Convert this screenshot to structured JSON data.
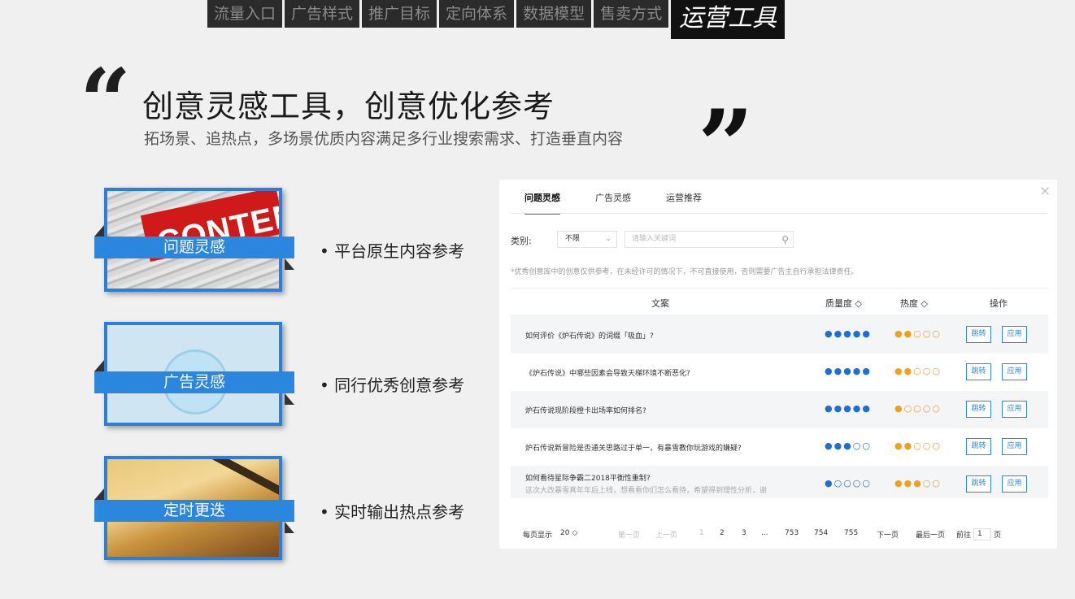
{
  "topnav": {
    "tabs": [
      "流量入口",
      "广告样式",
      "推广目标",
      "定向体系",
      "数据模型",
      "售卖方式"
    ],
    "active": "运营工具"
  },
  "heading": {
    "title": "创意灵感工具，创意优化参考",
    "subtitle": "拓场景、追热点，多场景优质内容满足多行业搜索需求、打造垂直内容"
  },
  "features": [
    {
      "label": "问题灵感",
      "bullet": "平台原生内容参考",
      "image_text": "CONTENT"
    },
    {
      "label": "广告灵感",
      "bullet": "同行优秀创意参考"
    },
    {
      "label": "定时更迭",
      "bullet": "实时输出热点参考"
    }
  ],
  "panel": {
    "tabs": [
      "问题灵感",
      "广告灵感",
      "运营推荐"
    ],
    "close": "×",
    "filter_label": "类别:",
    "select_value": "不限",
    "search_placeholder": "请输入关键词",
    "notice": "*优秀创意库中的创意仅供参考，在未经许可的情况下，不可直接使用，否则需要广告主自行承担法律责任。",
    "columns": {
      "text": "文案",
      "quality": "质量度 ◇",
      "heat": "热度 ◇",
      "ops": "操作"
    },
    "rows": [
      {
        "text": "如何评价《炉石传说》的词缀「吸血」?",
        "quality": "●●●●●",
        "heat": "●●○○○",
        "jump": "跳转",
        "apply": "应用"
      },
      {
        "text": "《炉石传说》中哪些因素会导致天梯环境不断恶化?",
        "quality": "●●●●●",
        "heat": "●●○○○",
        "jump": "跳转",
        "apply": "应用"
      },
      {
        "text": "炉石传说现阶段橙卡出场率如何排名?",
        "quality": "●●●●●",
        "heat": "●○○○○",
        "jump": "跳转",
        "apply": "应用"
      },
      {
        "text": "炉石传说新冒险是否通关思路过于单一，有暴雪教你玩游戏的嫌疑?",
        "quality": "●●●○○",
        "heat": "●●○○○",
        "jump": "跳转",
        "apply": "应用"
      },
      {
        "text": "如何看待星际争霸二2018平衡性重制?",
        "text2": "这次大改暴雪真年年后上线，想看看你们怎么看待，希望得到理性分析，谢",
        "quality": "●○○○○",
        "heat": "●●●○○",
        "jump": "跳转",
        "apply": "应用"
      }
    ],
    "pager": {
      "per_page_label": "每页显示",
      "per_page": "20 ◇",
      "first": "第一页",
      "prev": "上一页",
      "p1": "1",
      "p2": "2",
      "p3": "3",
      "ellipsis": "...",
      "p753": "753",
      "p754": "754",
      "p755": "755",
      "next": "下一页",
      "last": "最后一页",
      "goto_prefix": "前往",
      "goto_value": "1",
      "goto_suffix": "页"
    }
  }
}
